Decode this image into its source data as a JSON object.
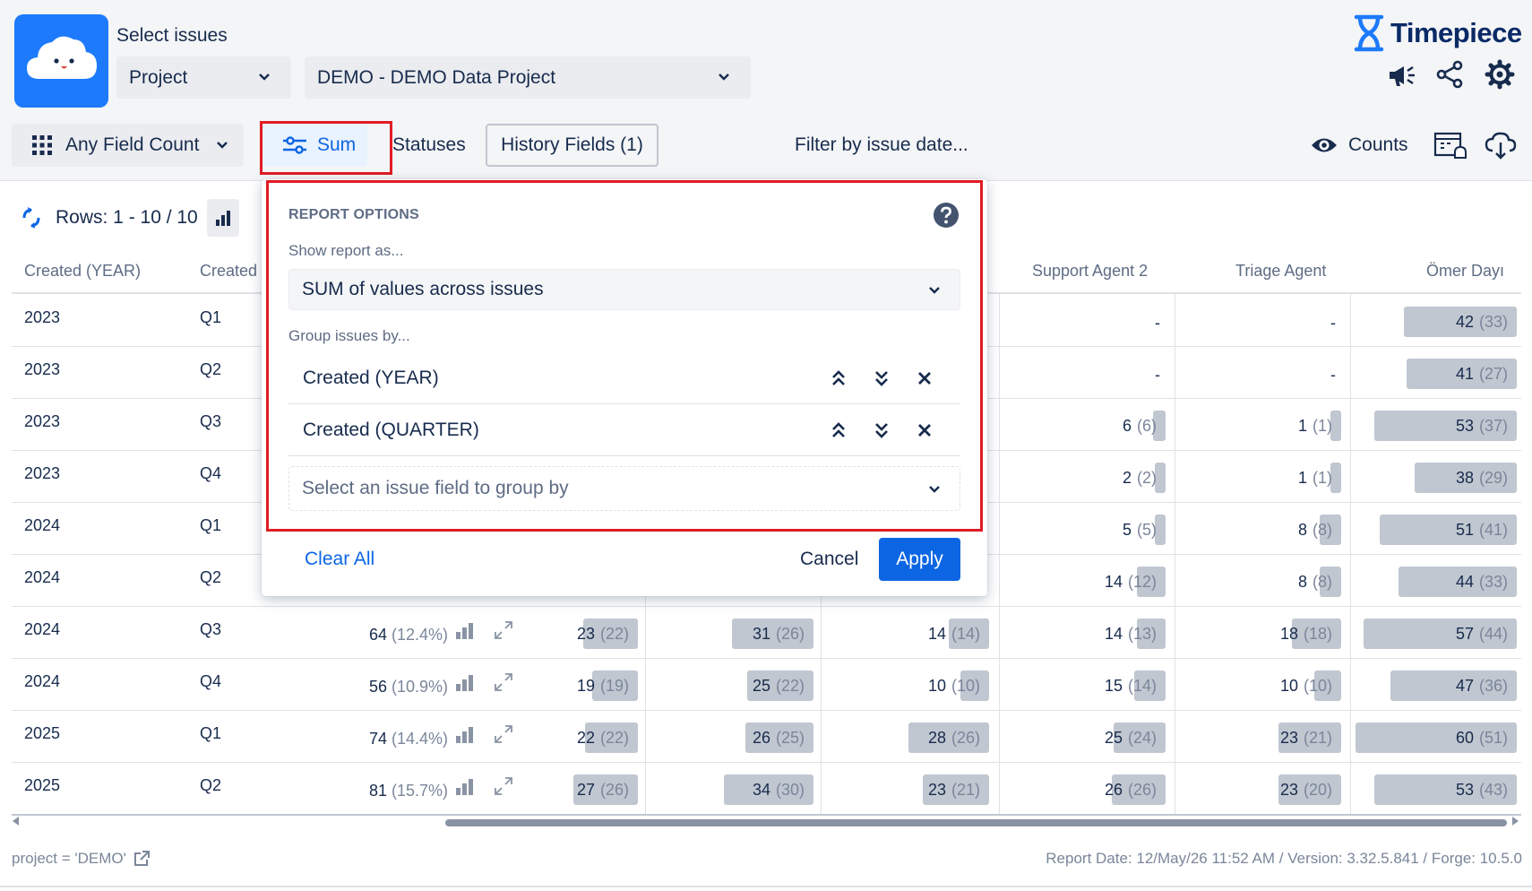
{
  "header": {
    "select_label": "Select issues",
    "scope_dropdown": "Project",
    "project_dropdown": "DEMO - DEMO Data Project",
    "brand": "Timepiece"
  },
  "toolbar": {
    "field_count": "Any Field Count",
    "sum": "Sum",
    "statuses": "Statuses",
    "history_fields": "History Fields (1)",
    "filter_date": "Filter by issue date...",
    "counts": "Counts"
  },
  "rows_info": "Rows: 1 - 10 / 10",
  "columns": {
    "created_year": "Created (YEAR)",
    "created_quarter": "Created",
    "support_agent_2": "Support Agent 2",
    "triage_agent": "Triage Agent",
    "omer_dayi": "Ömer Dayı"
  },
  "rows": [
    {
      "year": "2023",
      "quarter": "Q1"
    },
    {
      "year": "2023",
      "quarter": "Q2"
    },
    {
      "year": "2023",
      "quarter": "Q3"
    },
    {
      "year": "2023",
      "quarter": "Q4"
    },
    {
      "year": "2024",
      "quarter": "Q1"
    },
    {
      "year": "2024",
      "quarter": "Q2"
    },
    {
      "year": "2024",
      "quarter": "Q3"
    },
    {
      "year": "2024",
      "quarter": "Q4"
    },
    {
      "year": "2025",
      "quarter": "Q1"
    },
    {
      "year": "2025",
      "quarter": "Q2"
    }
  ],
  "visible_cells": {
    "support_agent_2": [
      {
        "v": "-",
        "p": ""
      },
      {
        "v": "-",
        "p": ""
      },
      {
        "v": "6",
        "p": "(6)"
      },
      {
        "v": "2",
        "p": "(2)"
      },
      {
        "v": "5",
        "p": "(5)"
      },
      {
        "v": "14",
        "p": "(12)"
      },
      {
        "v": "14",
        "p": "(13)"
      },
      {
        "v": "15",
        "p": "(14)"
      },
      {
        "v": "25",
        "p": "(24)"
      },
      {
        "v": "26",
        "p": "(26)"
      }
    ],
    "triage_agent": [
      {
        "v": "-",
        "p": ""
      },
      {
        "v": "-",
        "p": ""
      },
      {
        "v": "1",
        "p": "(1)"
      },
      {
        "v": "1",
        "p": "(1)"
      },
      {
        "v": "8",
        "p": "(8)"
      },
      {
        "v": "8",
        "p": "(8)"
      },
      {
        "v": "18",
        "p": "(18)"
      },
      {
        "v": "10",
        "p": "(10)"
      },
      {
        "v": "23",
        "p": "(21)"
      },
      {
        "v": "23",
        "p": "(20)"
      }
    ],
    "omer_dayi": [
      {
        "v": "42",
        "p": "(33)"
      },
      {
        "v": "41",
        "p": "(27)"
      },
      {
        "v": "53",
        "p": "(37)"
      },
      {
        "v": "38",
        "p": "(29)"
      },
      {
        "v": "51",
        "p": "(41)"
      },
      {
        "v": "44",
        "p": "(33)"
      },
      {
        "v": "57",
        "p": "(44)"
      },
      {
        "v": "47",
        "p": "(36)"
      },
      {
        "v": "60",
        "p": "(51)"
      },
      {
        "v": "53",
        "p": "(43)"
      }
    ],
    "lower_rows": [
      {
        "total": "64",
        "pct": "(12.4%)",
        "c1": "23",
        "c1p": "(22)",
        "c2": "31",
        "c2p": "(26)",
        "c3": "14",
        "c3p": "(14)"
      },
      {
        "total": "56",
        "pct": "(10.9%)",
        "c1": "19",
        "c1p": "(19)",
        "c2": "25",
        "c2p": "(22)",
        "c3": "10",
        "c3p": "(10)"
      },
      {
        "total": "74",
        "pct": "(14.4%)",
        "c1": "22",
        "c1p": "(22)",
        "c2": "26",
        "c2p": "(25)",
        "c3": "28",
        "c3p": "(26)"
      },
      {
        "total": "81",
        "pct": "(15.7%)",
        "c1": "27",
        "c1p": "(26)",
        "c2": "34",
        "c2p": "(30)",
        "c3": "23",
        "c3p": "(21)"
      }
    ]
  },
  "popup": {
    "title": "REPORT OPTIONS",
    "show_as_label": "Show report as...",
    "show_as_value": "SUM of values across issues",
    "group_label": "Group issues by...",
    "groups": [
      "Created (YEAR)",
      "Created (QUARTER)"
    ],
    "group_placeholder": "Select an issue field to group by",
    "clear_all": "Clear All",
    "cancel": "Cancel",
    "apply": "Apply"
  },
  "footer": {
    "jql": "project = 'DEMO'",
    "report_info": "Report Date: 12/May/26 11:52 AM / Version: 3.32.5.841 / Forge: 10.5.0"
  },
  "colors": {
    "accent": "#0c66e4",
    "highlight": "#e01b24",
    "bar": "#c1c7d0"
  }
}
